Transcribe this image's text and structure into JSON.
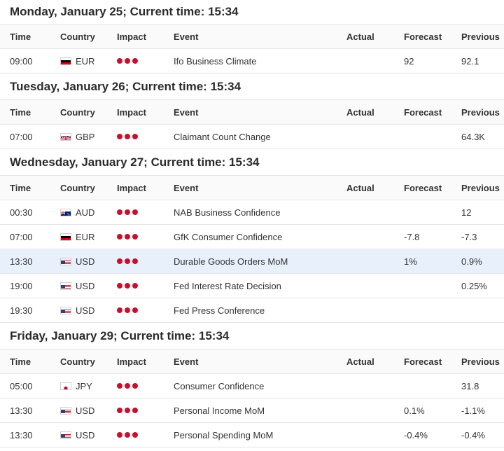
{
  "columns": {
    "time": "Time",
    "country": "Country",
    "impact": "Impact",
    "event": "Event",
    "actual": "Actual",
    "forecast": "Forecast",
    "previous": "Previous"
  },
  "impact_color": "#c8102e",
  "highlight_color": "#e8f1fb",
  "days": [
    {
      "title": "Monday, January 25; Current time: 15:34",
      "events": [
        {
          "time": "09:00",
          "flag": "de-flag-icon",
          "currency": "EUR",
          "impact": 3,
          "event": "Ifo Business Climate",
          "actual": "",
          "forecast": "92",
          "previous": "92.1",
          "highlight": false
        }
      ]
    },
    {
      "title": "Tuesday, January 26; Current time: 15:34",
      "events": [
        {
          "time": "07:00",
          "flag": "gb-flag-icon",
          "currency": "GBP",
          "impact": 3,
          "event": "Claimant Count Change",
          "actual": "",
          "forecast": "",
          "previous": "64.3K",
          "highlight": false
        }
      ]
    },
    {
      "title": "Wednesday, January 27; Current time: 15:34",
      "events": [
        {
          "time": "00:30",
          "flag": "au-flag-icon",
          "currency": "AUD",
          "impact": 3,
          "event": "NAB Business Confidence",
          "actual": "",
          "forecast": "",
          "previous": "12",
          "highlight": false
        },
        {
          "time": "07:00",
          "flag": "de-flag-icon",
          "currency": "EUR",
          "impact": 3,
          "event": "GfK Consumer Confidence",
          "actual": "",
          "forecast": "-7.8",
          "previous": "-7.3",
          "highlight": false
        },
        {
          "time": "13:30",
          "flag": "us-flag-icon",
          "currency": "USD",
          "impact": 3,
          "event": "Durable Goods Orders MoM",
          "actual": "",
          "forecast": "1%",
          "previous": "0.9%",
          "highlight": true
        },
        {
          "time": "19:00",
          "flag": "us-flag-icon",
          "currency": "USD",
          "impact": 3,
          "event": "Fed Interest Rate Decision",
          "actual": "",
          "forecast": "",
          "previous": "0.25%",
          "highlight": false
        },
        {
          "time": "19:30",
          "flag": "us-flag-icon",
          "currency": "USD",
          "impact": 3,
          "event": "Fed Press Conference",
          "actual": "",
          "forecast": "",
          "previous": "",
          "highlight": false
        }
      ]
    },
    {
      "title": "Friday, January 29; Current time: 15:34",
      "events": [
        {
          "time": "05:00",
          "flag": "jp-flag-icon",
          "currency": "JPY",
          "impact": 3,
          "event": "Consumer Confidence",
          "actual": "",
          "forecast": "",
          "previous": "31.8",
          "highlight": false
        },
        {
          "time": "13:30",
          "flag": "us-flag-icon",
          "currency": "USD",
          "impact": 3,
          "event": "Personal Income MoM",
          "actual": "",
          "forecast": "0.1%",
          "previous": "-1.1%",
          "highlight": false
        },
        {
          "time": "13:30",
          "flag": "us-flag-icon",
          "currency": "USD",
          "impact": 3,
          "event": "Personal Spending MoM",
          "actual": "",
          "forecast": "-0.4%",
          "previous": "-0.4%",
          "highlight": false
        }
      ]
    }
  ]
}
